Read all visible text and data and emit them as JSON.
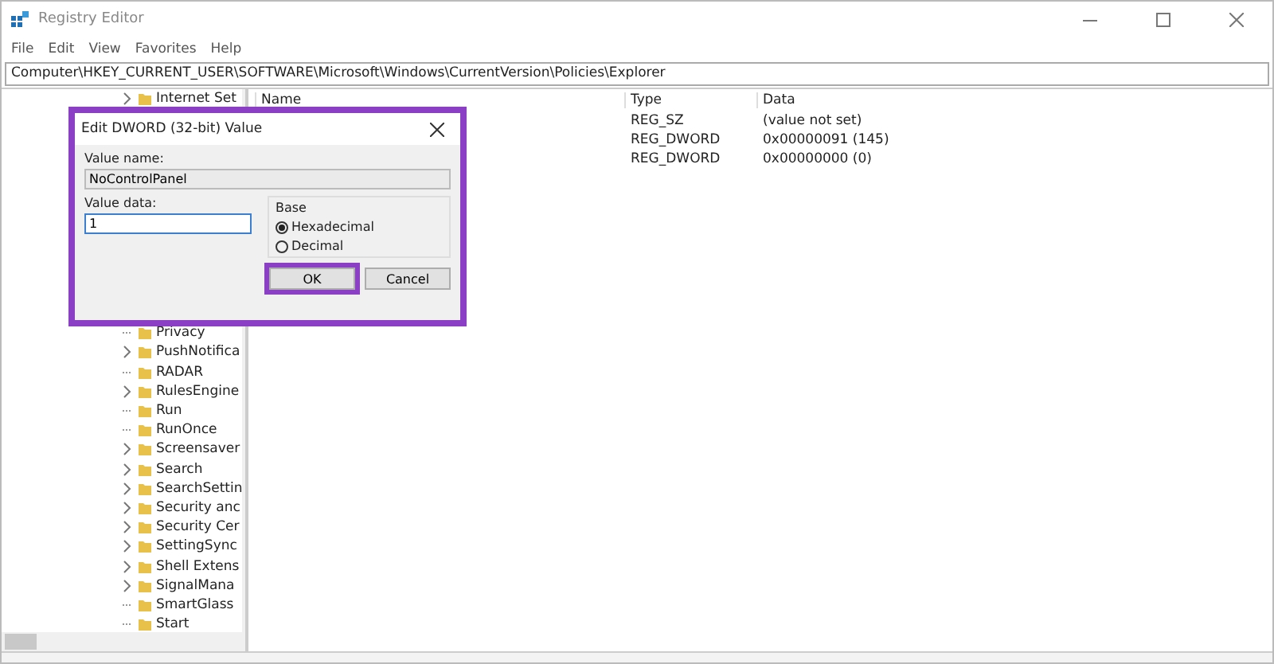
{
  "window": {
    "title": "Registry Editor"
  },
  "menu": [
    "File",
    "Edit",
    "View",
    "Favorites",
    "Help"
  ],
  "address": "Computer\\HKEY_CURRENT_USER\\SOFTWARE\\Microsoft\\Windows\\CurrentVersion\\Policies\\Explorer",
  "tree": {
    "top_item": {
      "label": "Internet Set",
      "expandable": true
    },
    "items": [
      {
        "label": "Privacy",
        "expandable": false
      },
      {
        "label": "PushNotifica",
        "expandable": true
      },
      {
        "label": "RADAR",
        "expandable": false
      },
      {
        "label": "RulesEngine",
        "expandable": true
      },
      {
        "label": "Run",
        "expandable": false
      },
      {
        "label": "RunOnce",
        "expandable": false
      },
      {
        "label": "Screensaver",
        "expandable": true
      },
      {
        "label": "Search",
        "expandable": true
      },
      {
        "label": "SearchSettin",
        "expandable": true
      },
      {
        "label": "Security anc",
        "expandable": true
      },
      {
        "label": "Security Cer",
        "expandable": true
      },
      {
        "label": "SettingSync",
        "expandable": true
      },
      {
        "label": "Shell Extens",
        "expandable": true
      },
      {
        "label": "SignalMana",
        "expandable": true
      },
      {
        "label": "SmartGlass",
        "expandable": false
      },
      {
        "label": "Start",
        "expandable": false
      }
    ]
  },
  "table": {
    "columns": [
      "Name",
      "Type",
      "Data"
    ],
    "rows": [
      {
        "type": "REG_SZ",
        "data": "(value not set)"
      },
      {
        "type": "REG_DWORD",
        "data": "0x00000091 (145)"
      },
      {
        "type": "REG_DWORD",
        "data": "0x00000000 (0)"
      }
    ]
  },
  "dialog": {
    "title": "Edit DWORD (32-bit) Value",
    "value_name_label": "Value name:",
    "value_name": "NoControlPanel",
    "value_data_label": "Value data:",
    "value_data": "1",
    "base_label": "Base",
    "base_options": [
      {
        "label": "Hexadecimal",
        "selected": true
      },
      {
        "label": "Decimal",
        "selected": false
      }
    ],
    "buttons": [
      {
        "label": "OK",
        "highlighted": true
      },
      {
        "label": "Cancel",
        "highlighted": false
      }
    ]
  }
}
